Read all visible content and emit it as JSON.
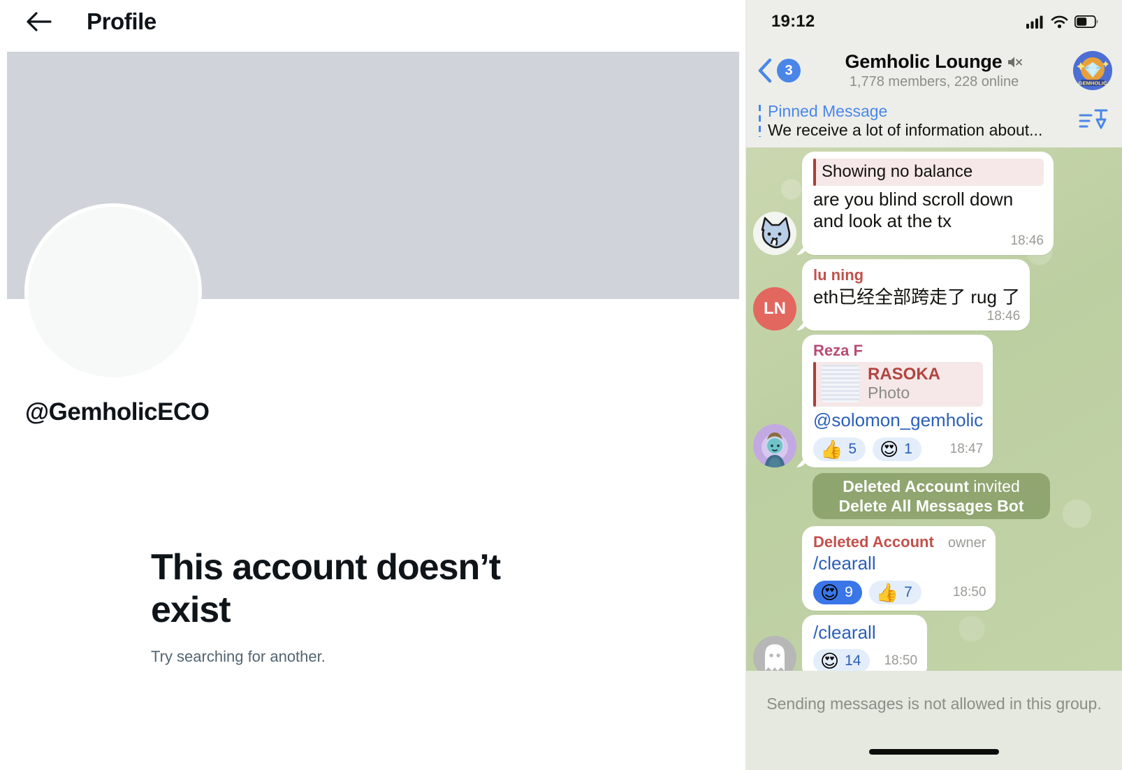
{
  "profile": {
    "nav": {
      "back_icon": "arrow-left-icon",
      "title": "Profile"
    },
    "handle": "@GemholicECO",
    "empty_title": "This account doesn’t exist",
    "empty_subtitle": "Try searching for another.",
    "banner_color": "#d0d4da",
    "avatar_color": "#f7f9f9"
  },
  "telegram": {
    "status_bar": {
      "time": "19:12",
      "icons": [
        "cellular-signal-icon",
        "wifi-icon",
        "battery-icon"
      ]
    },
    "navbar": {
      "back_icon": "chevron-left-icon",
      "unread_badge": "3",
      "title": "Gemholic Lounge",
      "mute_icon": "muted-speaker-icon",
      "subtitle": "1,778 members, 228 online",
      "avatar_label": "GEMHOLIC"
    },
    "pinned": {
      "label": "Pinned Message",
      "snippet": "We receive a lot of information about...",
      "icon": "pin-list-icon"
    },
    "messages": [
      {
        "id": "m1",
        "avatar": "cat-avatar",
        "sender": null,
        "quote": {
          "kind": "text",
          "text": "Showing no balance"
        },
        "text": "are you blind scroll down and look at the tx",
        "time": "18:46",
        "reactions": []
      },
      {
        "id": "m2",
        "avatar": "ln-avatar",
        "avatar_initials": "LN",
        "sender": "lu ning",
        "sender_color": "#c2504c",
        "text": "eth已经全部跨走了 rug 了",
        "time": "18:46",
        "reactions": []
      },
      {
        "id": "m3",
        "avatar": "purple-character-avatar",
        "sender": "Reza F",
        "sender_color": "#b74c72",
        "quote": {
          "kind": "photo",
          "title": "RASOKA",
          "subtitle": "Photo"
        },
        "text": "@solomon_gemholic",
        "text_is_link": true,
        "time": "18:47",
        "reactions": [
          {
            "emoji": "👍",
            "count": "5",
            "active": false
          },
          {
            "emoji": "😍",
            "count": "1",
            "active": false
          }
        ]
      }
    ],
    "service_message": {
      "actor": "Deleted Account",
      "verb": "invited",
      "target": "Delete All Messages Bot"
    },
    "messages_after": [
      {
        "id": "m4",
        "avatar": null,
        "sender": "Deleted Account",
        "sender_color": "#c2504c",
        "badge": "owner",
        "text": "/clearall",
        "text_is_link": true,
        "time": "18:50",
        "reactions": [
          {
            "emoji": "😍",
            "count": "9",
            "active": true
          },
          {
            "emoji": "👍",
            "count": "7",
            "active": false
          }
        ]
      },
      {
        "id": "m5",
        "avatar": "ghost-avatar",
        "sender": null,
        "text": "/clearall",
        "text_is_link": true,
        "time": "18:50",
        "reactions": [
          {
            "emoji": "😍",
            "count": "14",
            "active": false
          }
        ]
      }
    ],
    "footer": {
      "note": "Sending messages is not allowed in this group."
    },
    "colors": {
      "chat_background": "#c6d3aa",
      "bubble": "#ffffff",
      "link": "#2b5fb8",
      "accent_blue": "#4a86e8",
      "reaction_active": "#3a76e8"
    }
  }
}
